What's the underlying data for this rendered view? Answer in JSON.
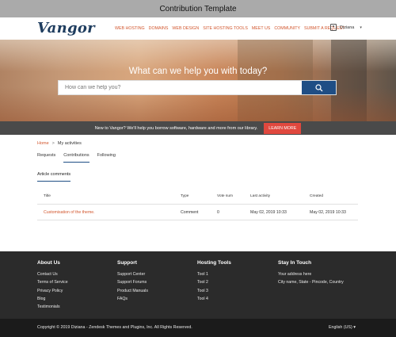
{
  "window": {
    "title": "Contribution Template"
  },
  "header": {
    "logo": "Vangor",
    "nav": [
      "WEB HOSTING",
      "DOMAINS",
      "WEB DESIGN",
      "SITE HOSTING TOOLS",
      "MEET US",
      "COMMUNITY",
      "SUBMIT A REQUEST"
    ],
    "user": {
      "name": "Diziana",
      "icon": "user-icon"
    }
  },
  "hero": {
    "title": "What can we help you with today?",
    "search_placeholder": "How can we help you?",
    "search_icon": "search-icon"
  },
  "promo": {
    "text": "New to Vangor? We'll help you borrow software, hardware and more from our library.",
    "button": "LEARN MORE"
  },
  "breadcrumb": {
    "home": "Home",
    "separator": ">",
    "current": "My activities"
  },
  "tabs": {
    "requests": "Requests",
    "contributions": "Contributions",
    "following": "Following",
    "active": "Contributions"
  },
  "subtab": {
    "label": "Article comments"
  },
  "table": {
    "headers": {
      "title": "Title",
      "type": "Type",
      "votes": "Vote sum",
      "activity": "Last activity",
      "created": "Created"
    },
    "rows": [
      {
        "title": "Customisation of the theme.",
        "type": "Comment",
        "votes": "0",
        "activity": "May 02, 2019 10:33",
        "created": "May 02, 2019 10:33"
      }
    ]
  },
  "footer": {
    "about": {
      "heading": "About Us",
      "items": [
        "Contact Us",
        "Terms of Service",
        "Privacy Policy",
        "Blog",
        "Testimonials"
      ]
    },
    "support": {
      "heading": "Support",
      "items": [
        "Support Center",
        "Support Forums",
        "Product Manuals",
        "FAQs"
      ]
    },
    "tools": {
      "heading": "Hosting Tools",
      "items": [
        "Tool 1",
        "Tool 2",
        "Tool 3",
        "Tool 4"
      ]
    },
    "contact": {
      "heading": "Stay In Touch",
      "items": [
        "Your address here",
        "City name, State - Pincode, Country"
      ]
    }
  },
  "copyright": {
    "text": "Copyright © 2019 Diziana - Zendesk Themes and Plugins, Inc. All Rights Reserved.",
    "language": "English (US)"
  },
  "colors": {
    "accent": "#d2562d",
    "primary": "#1f4e85",
    "promo_button": "#e0483e",
    "footer_bg": "#2b2b2b",
    "copyright_bg": "#1b1b1b"
  }
}
